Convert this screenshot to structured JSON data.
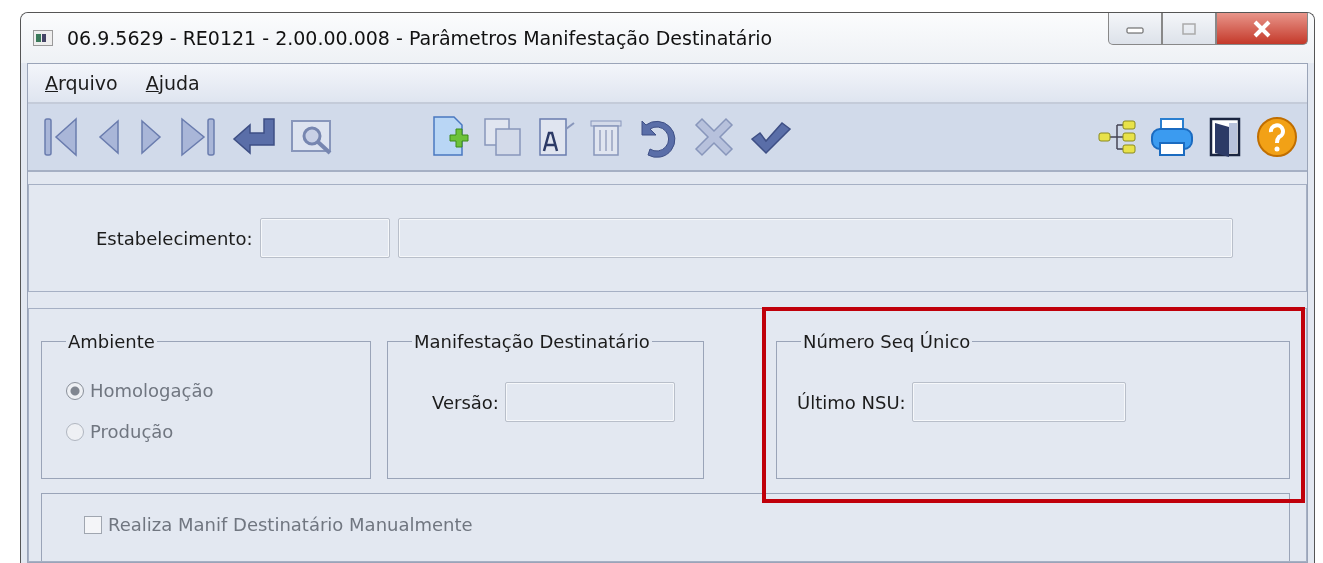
{
  "window": {
    "title": "06.9.5629 - RE0121 - 2.00.00.008 - Parâmetros Manifestação Destinatário"
  },
  "menu": [
    {
      "label": "Arquivo"
    },
    {
      "label": "Ajuda"
    }
  ],
  "establishment": {
    "label": "Estabelecimento:"
  },
  "environment": {
    "title": "Ambiente",
    "disabled": true,
    "options": [
      {
        "label": "Homologação",
        "selected": true
      },
      {
        "label": "Produção",
        "selected": false
      }
    ]
  },
  "recipient": {
    "title": "Manifestação Destinatário",
    "version_label": "Versão:"
  },
  "nsu": {
    "title": "Número Seq Único",
    "last_nsu_label": "Último NSU:",
    "highlighted": true
  },
  "manual": {
    "label": "Realiza Manif Destinatário Manualmente",
    "checked": false
  }
}
